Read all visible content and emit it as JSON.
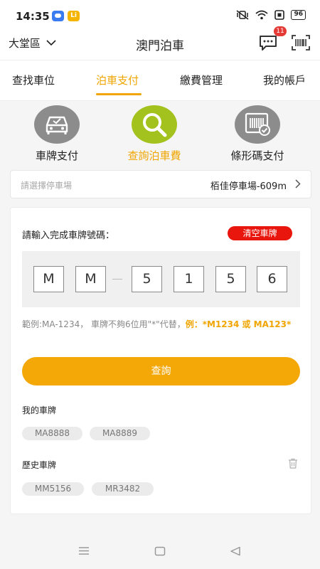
{
  "status_bar": {
    "time": "14:35",
    "app2_glyph": "Li",
    "battery": "96",
    "icons": [
      "notification-app-icon",
      "app-icon",
      "mute-vibrate-icon",
      "wifi-icon",
      "sim-icon",
      "battery-icon"
    ]
  },
  "header": {
    "district": "大堂區",
    "title": "澳門泊車",
    "message_badge": "11",
    "icons": [
      "chevron-down-icon",
      "message-icon",
      "barcode-scan-icon"
    ]
  },
  "tabs": [
    {
      "label": "查找車位",
      "active": false
    },
    {
      "label": "泊車支付",
      "active": true
    },
    {
      "label": "繳費管理",
      "active": false
    },
    {
      "label": "我的帳戶",
      "active": false
    }
  ],
  "methods": [
    {
      "label": "車牌支付",
      "icon": "car-check-icon",
      "active": false
    },
    {
      "label": "查詢泊車費",
      "icon": "search-icon",
      "active": true
    },
    {
      "label": "條形碼支付",
      "icon": "barcode-card-icon",
      "active": false
    }
  ],
  "lot_selector": {
    "placeholder": "請選擇停車場",
    "value": "栢佳停車場-609m"
  },
  "plate_form": {
    "prompt": "請輸入完成車牌號碼：",
    "clear_label": "清空車牌",
    "chars": [
      "M",
      "M",
      "5",
      "1",
      "5",
      "6"
    ],
    "example_prefix": "範例:MA-1234， 車牌不夠6位用\"*\"代替，",
    "example_highlight": "例：*M1234 或 MA123*",
    "query_label": "查詢"
  },
  "my_plates": {
    "title": "我的車牌",
    "items": [
      "MA8888",
      "MA8889"
    ]
  },
  "history_plates": {
    "title": "歷史車牌",
    "items": [
      "MM5156",
      "MR3482"
    ]
  },
  "colors": {
    "accent": "#f0a500",
    "active_method": "#a3c21d",
    "clear_button": "#e8160c",
    "query_button": "#f3a808",
    "inactive_method": "#8c8c8c"
  }
}
